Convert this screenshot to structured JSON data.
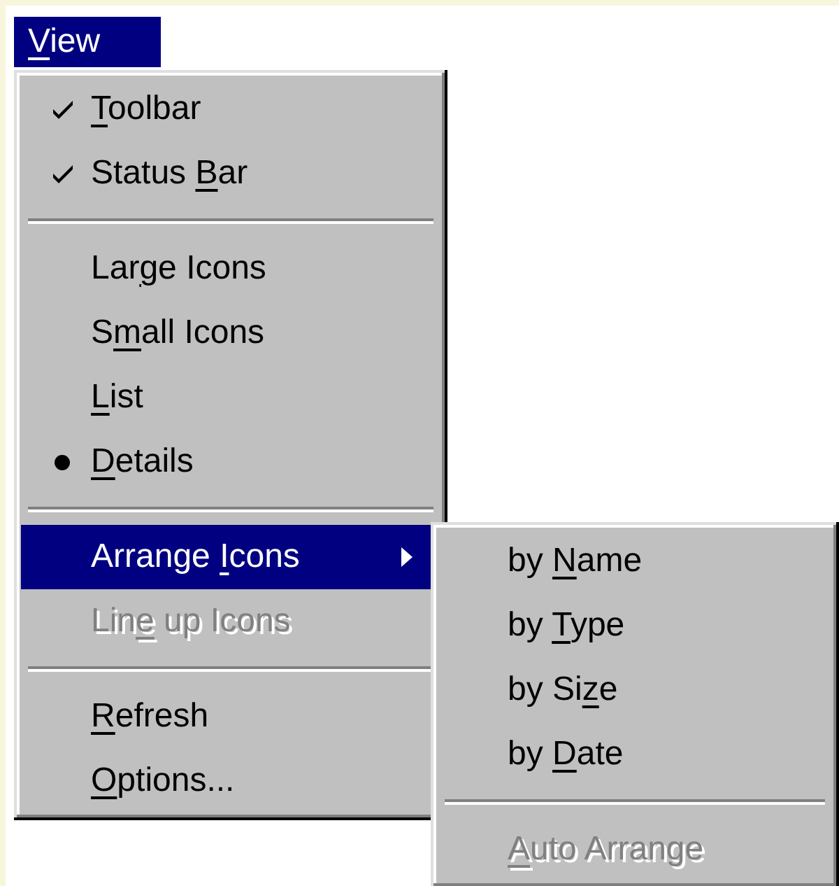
{
  "menu_bar": {
    "label": {
      "key": "V",
      "after": "iew"
    },
    "highlighted": true
  },
  "menu": {
    "items": [
      {
        "kind": "check",
        "label": {
          "key": "T",
          "after": "oolbar"
        },
        "checked": true,
        "highlighted": false,
        "disabled": false
      },
      {
        "kind": "check",
        "label": {
          "before": "Status ",
          "key": "B",
          "after": "ar"
        },
        "checked": true,
        "highlighted": false,
        "disabled": false
      },
      {
        "kind": "separator"
      },
      {
        "kind": "radio",
        "label": {
          "before": "Lar",
          "key": "g",
          "after": "e Icons"
        },
        "selected": false,
        "highlighted": false,
        "disabled": false
      },
      {
        "kind": "radio",
        "label": {
          "before": "S",
          "key": "m",
          "after": "all Icons"
        },
        "selected": false,
        "highlighted": false,
        "disabled": false
      },
      {
        "kind": "radio",
        "label": {
          "key": "L",
          "after": "ist"
        },
        "selected": false,
        "highlighted": false,
        "disabled": false
      },
      {
        "kind": "radio",
        "label": {
          "key": "D",
          "after": "etails"
        },
        "selected": true,
        "highlighted": false,
        "disabled": false
      },
      {
        "kind": "separator"
      },
      {
        "kind": "submenu",
        "label": {
          "before": "Arrange ",
          "key": "I",
          "after": "cons"
        },
        "highlighted": true,
        "disabled": false
      },
      {
        "kind": "command",
        "label": {
          "before": "Lin",
          "key": "e",
          "after": " up Icons"
        },
        "highlighted": false,
        "disabled": true
      },
      {
        "kind": "separator"
      },
      {
        "kind": "command",
        "label": {
          "key": "R",
          "after": "efresh"
        },
        "highlighted": false,
        "disabled": false
      },
      {
        "kind": "command",
        "label": {
          "key": "O",
          "after": "ptions..."
        },
        "highlighted": false,
        "disabled": false
      }
    ]
  },
  "submenu": {
    "items": [
      {
        "kind": "command",
        "label": {
          "before": "by ",
          "key": "N",
          "after": "ame"
        },
        "highlighted": false,
        "disabled": false
      },
      {
        "kind": "command",
        "label": {
          "before": "by ",
          "key": "T",
          "after": "ype"
        },
        "highlighted": false,
        "disabled": false
      },
      {
        "kind": "command",
        "label": {
          "before": "by Si",
          "key": "z",
          "after": "e"
        },
        "highlighted": false,
        "disabled": false
      },
      {
        "kind": "command",
        "label": {
          "before": "by ",
          "key": "D",
          "after": "ate"
        },
        "highlighted": false,
        "disabled": false
      },
      {
        "kind": "separator"
      },
      {
        "kind": "command",
        "label": {
          "key": "A",
          "after": "uto Arrange"
        },
        "highlighted": false,
        "disabled": true
      }
    ]
  }
}
